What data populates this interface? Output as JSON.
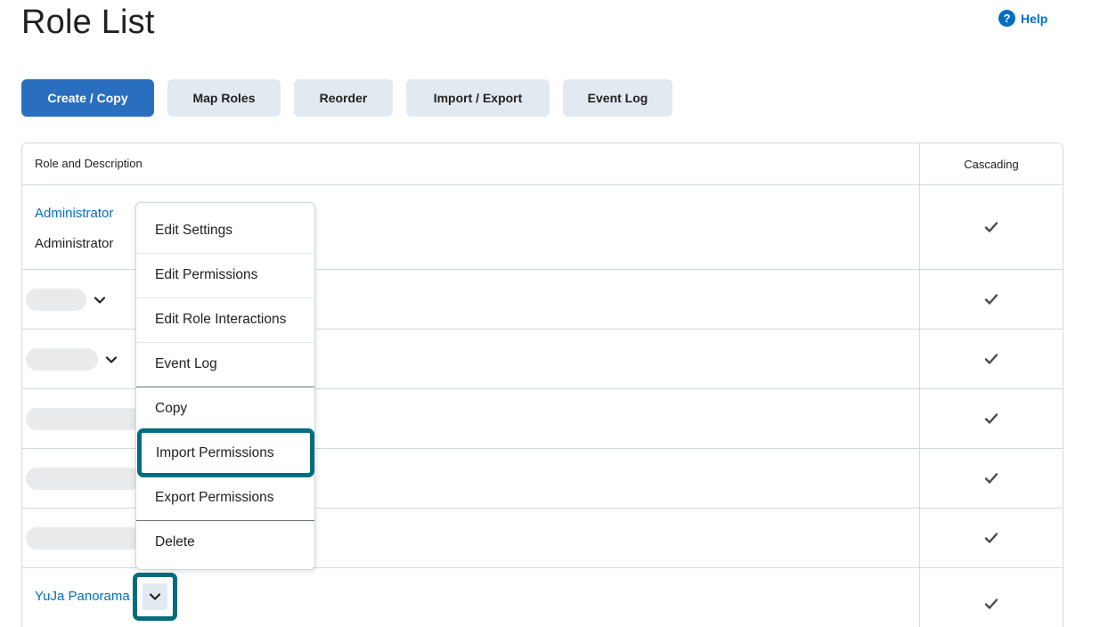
{
  "page": {
    "title": "Role List",
    "help_label": "Help"
  },
  "toolbar": {
    "buttons": [
      {
        "label": "Create / Copy"
      },
      {
        "label": "Map Roles"
      },
      {
        "label": "Reorder"
      },
      {
        "label": "Import / Export"
      },
      {
        "label": "Event Log"
      }
    ]
  },
  "table": {
    "headers": {
      "role": "Role and Description",
      "cascading": "Cascading"
    },
    "rows": [
      {
        "role_name": "Administrator",
        "description": "Administrator",
        "cascading": true
      },
      {
        "role_name": "",
        "cascading": true
      },
      {
        "role_name": "",
        "cascading": true
      },
      {
        "role_name": "",
        "cascading": true
      },
      {
        "role_name": "",
        "cascading": true
      },
      {
        "role_name": "",
        "cascading": true
      },
      {
        "role_name": "YuJa Panorama",
        "cascading": true
      }
    ]
  },
  "menu": {
    "items": [
      {
        "label": "Edit Settings"
      },
      {
        "label": "Edit Permissions"
      },
      {
        "label": "Edit Role Interactions"
      },
      {
        "label": "Event Log"
      },
      {
        "label": "Copy"
      },
      {
        "label": "Import Permissions"
      },
      {
        "label": "Export Permissions"
      },
      {
        "label": "Delete"
      }
    ],
    "highlighted_item": "Import Permissions"
  },
  "colors": {
    "primary": "#2a6ebf",
    "link": "#006fbf",
    "highlight": "#006d7d",
    "secondary_btn": "#e3e9f1"
  },
  "icons": {
    "help": "help-circle-icon",
    "check": "check-icon",
    "chevron": "chevron-down-icon"
  }
}
